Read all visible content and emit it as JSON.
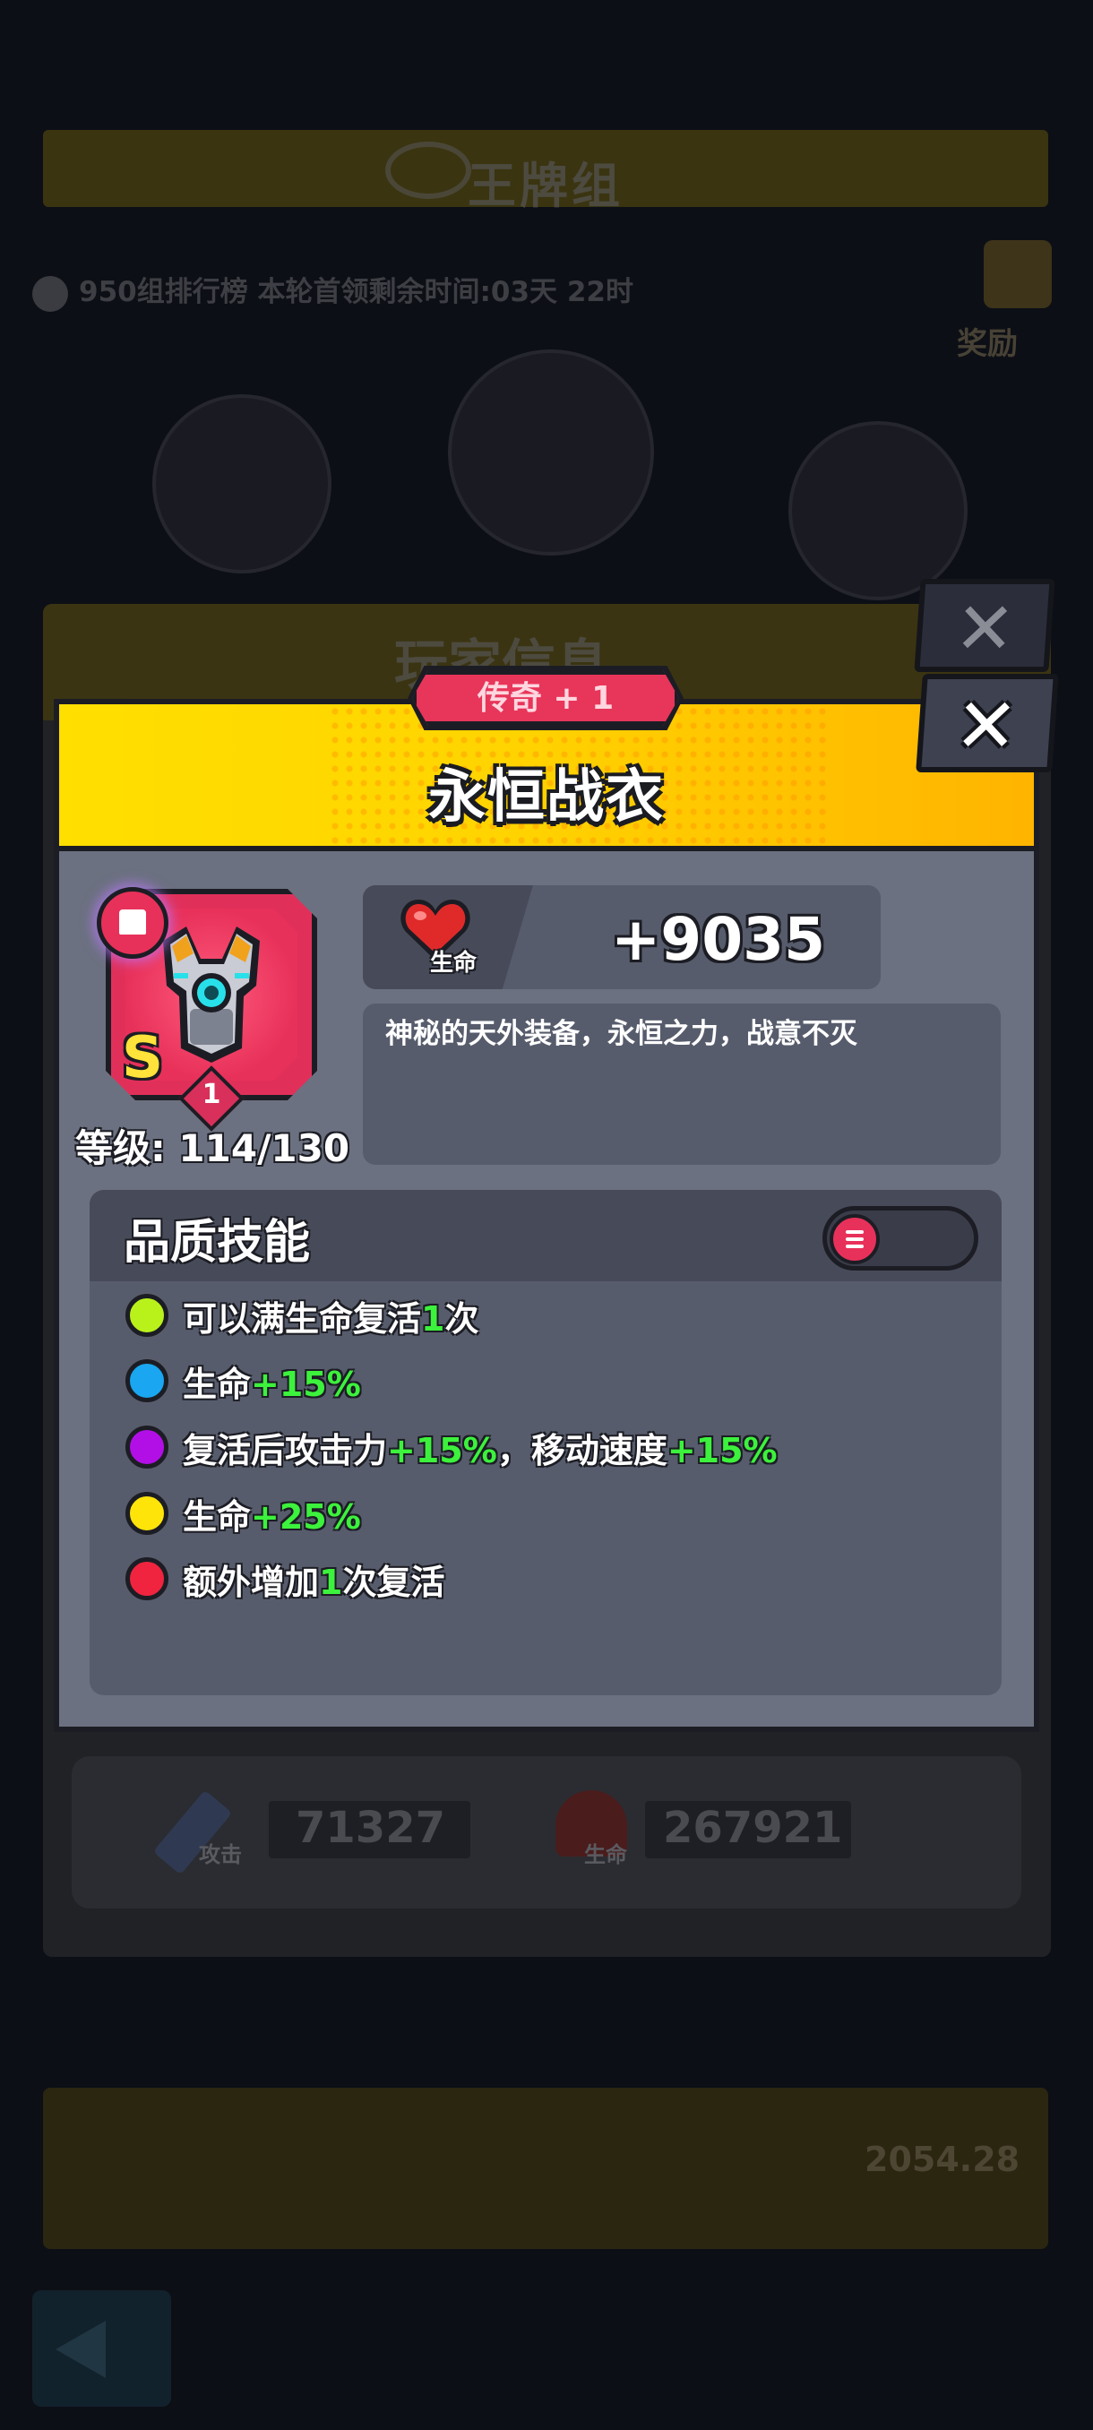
{
  "background": {
    "title": "王牌组",
    "rank_line": "950组排行榜    本轮首领剩余时间:03天 22时",
    "gift_label": "奖励",
    "panel_title": "玩家信息",
    "attack_label": "攻击",
    "attack_value": "71327",
    "life_label": "生命",
    "life_value": "267921",
    "bottom_value": "2054.28"
  },
  "dialog": {
    "rarity": "传奇 + 1",
    "title": "永恒战衣",
    "close_symbol": "✕",
    "item": {
      "grade": "S",
      "star": "1",
      "level_label": "等级: 114/130"
    },
    "stat": {
      "label": "生命",
      "value": "+9035"
    },
    "description": "神秘的天外装备，永恒之力，战意不灭",
    "skills_title": "品质技能",
    "skills": [
      {
        "color": "#b9f21b",
        "parts": [
          "可以满生命复活",
          "1",
          "次"
        ]
      },
      {
        "color": "#1aa6f0",
        "parts": [
          "生命",
          "+15%",
          ""
        ]
      },
      {
        "color": "#b20fe6",
        "parts": [
          "复活后攻击力",
          "+15%",
          "，移动速度",
          "+15%"
        ]
      },
      {
        "color": "#ffe40a",
        "parts": [
          "生命",
          "+25%",
          ""
        ]
      },
      {
        "color": "#f0243f",
        "parts": [
          "额外增加",
          "1",
          "次复活"
        ]
      }
    ]
  },
  "colors": {
    "header_yellow": "#ffd400",
    "legend_red": "#e8315a",
    "highlight_green": "#3cf23c"
  }
}
